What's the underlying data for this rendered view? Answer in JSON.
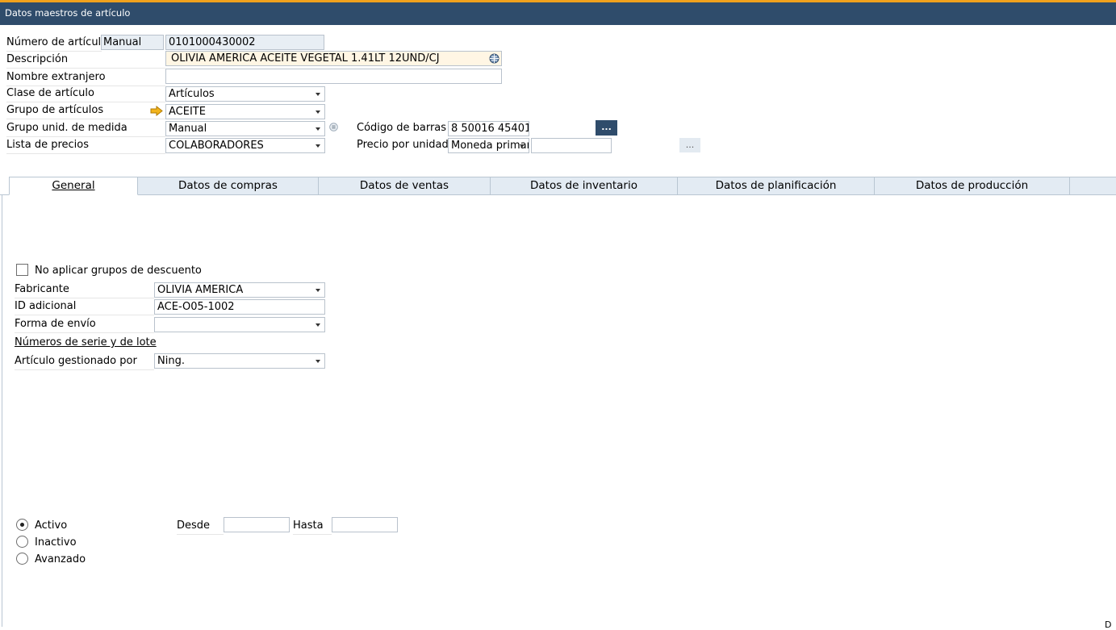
{
  "window": {
    "title": "Datos maestros de artículo"
  },
  "header": {
    "item_number_label": "Número de artículo",
    "item_number_mode": "Manual",
    "item_number": "0101000430002",
    "description_label": "Descripción",
    "description": "OLIVIA AMERICA ACEITE VEGETAL 1.41LT 12UND/CJ",
    "foreign_name_label": "Nombre extranjero",
    "foreign_name": "",
    "item_class_label": "Clase de artículo",
    "item_class": "Artículos",
    "item_group_label": "Grupo de artículos",
    "item_group": "ACEITE",
    "uom_group_label": "Grupo unid. de medida",
    "uom_group": "Manual",
    "price_list_label": "Lista de precios",
    "price_list": "COLABORADORES",
    "barcode_label": "Código de barras",
    "barcode": "8 50016 45401",
    "barcode_button": "...",
    "unit_price_label": "Precio por unidad",
    "unit_price_currency": "Moneda primar",
    "unit_price": "",
    "unit_price_button": "..."
  },
  "tabs": [
    {
      "label": "General"
    },
    {
      "label": "Datos de compras"
    },
    {
      "label": "Datos de ventas"
    },
    {
      "label": "Datos de inventario"
    },
    {
      "label": "Datos de planificación"
    },
    {
      "label": "Datos de producción"
    }
  ],
  "general": {
    "no_discount_label": "No aplicar grupos de descuento",
    "no_discount_checked": false,
    "manufacturer_label": "Fabricante",
    "manufacturer": "OLIVIA AMERICA",
    "additional_id_label": "ID adicional",
    "additional_id": "ACE-O05-1002",
    "shipping_type_label": "Forma de envío",
    "shipping_type": "",
    "serial_batch_label": "Números de serie y de lote",
    "managed_by_label": "Artículo gestionado por",
    "managed_by": "Ning.",
    "status_options": [
      "Activo",
      "Inactivo",
      "Avanzado"
    ],
    "status_selected": "Activo",
    "from_label": "Desde",
    "from_value": "",
    "to_label": "Hasta",
    "to_value": ""
  },
  "footer": {
    "partial_text": "D"
  },
  "icons": {
    "description_globe": "globe-icon",
    "group_link": "link-arrow-icon",
    "uom_info": "info-icon"
  },
  "colors": {
    "titlebar": "#2f4c6b",
    "accent": "#f0a11d",
    "description_bg": "#fff6e4"
  }
}
